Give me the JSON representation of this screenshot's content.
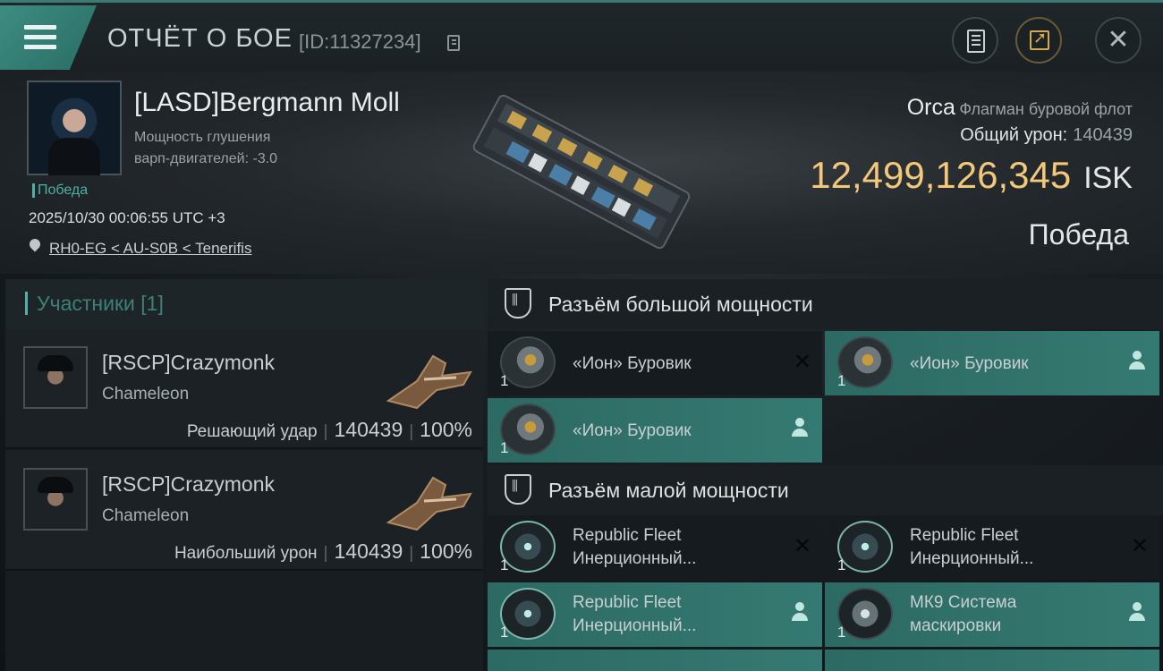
{
  "titlebar": {
    "title": "ОТЧЁТ О БОЕ",
    "report_id": "[ID:11327234]"
  },
  "victim": {
    "name": "[LASD]Bergmann Moll",
    "stat_line1": "Мощность глушения",
    "stat_line2": "варп-двигателей: -3.0",
    "status": "Победа",
    "timestamp": "2025/10/30 00:06:55 UTC +3",
    "location": "RH0-EG < AU-S0B < Tenerifis"
  },
  "ship": {
    "name": "Orca",
    "class": "Флагман буровой флот",
    "total_damage_label": "Общий урон:",
    "total_damage_value": "140439",
    "isk_value": "12,499,126,345",
    "isk_unit": "ISK",
    "outcome": "Победа"
  },
  "participants": {
    "header": "Участники [1]",
    "items": [
      {
        "name": "[RSCP]Crazymonk",
        "ship": "Chameleon",
        "role": "Решающий удар",
        "damage": "140439",
        "percent": "100%"
      },
      {
        "name": "[RSCP]Crazymonk",
        "ship": "Chameleon",
        "role": "Наибольший урон",
        "damage": "140439",
        "percent": "100%"
      }
    ]
  },
  "fitting": {
    "high_slots_label": "Разъём большой мощности",
    "low_slots_label": "Разъём малой мощности",
    "high_modules": [
      {
        "name": "«Ион» Буровик",
        "qty": "1",
        "state": "destroyed"
      },
      {
        "name": "«Ион» Буровик",
        "qty": "1",
        "state": "dropped"
      },
      {
        "name": "«Ион» Буровик",
        "qty": "1",
        "state": "dropped"
      }
    ],
    "low_modules": [
      {
        "name1": "Republic Fleet",
        "name2": "Инерционный...",
        "qty": "1",
        "state": "destroyed"
      },
      {
        "name1": "Republic Fleet",
        "name2": "Инерционный...",
        "qty": "1",
        "state": "destroyed"
      },
      {
        "name1": "Republic Fleet",
        "name2": "Инерционный...",
        "qty": "1",
        "state": "dropped"
      },
      {
        "name1": "МК9 Система",
        "name2": "маскировки",
        "qty": "1",
        "state": "dropped"
      }
    ]
  },
  "icons": {
    "menu": "menu-icon",
    "copy": "copy-icon",
    "report": "report-icon",
    "share": "share-icon",
    "close": "close-icon",
    "pin": "location-pin-icon",
    "slot": "shield-icon",
    "destroyed": "x-icon",
    "dropped": "person-icon"
  },
  "colors": {
    "accent_teal": "#3d8d82",
    "isk_gold": "#f2c87a",
    "fitted_bg": "#357a72"
  }
}
